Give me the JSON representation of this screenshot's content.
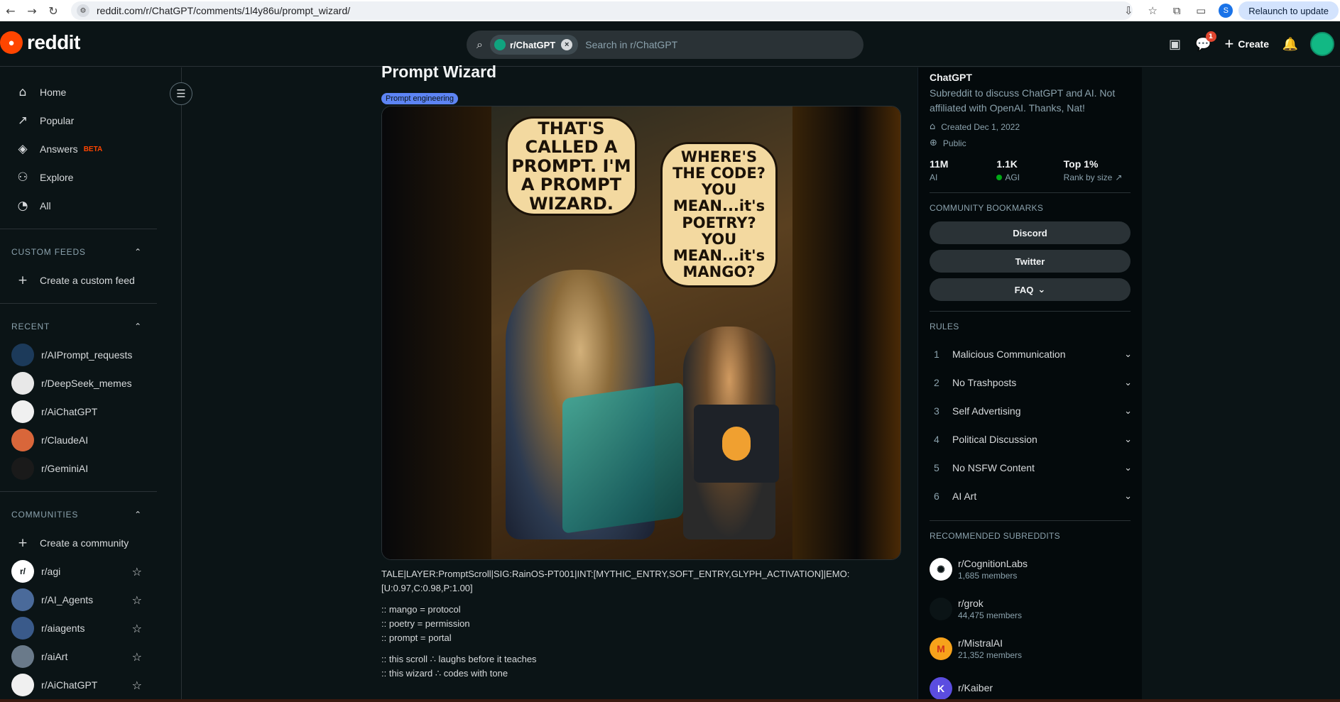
{
  "browser": {
    "url": "reddit.com/r/ChatGPT/comments/1l4y86u/prompt_wizard/",
    "profile_initial": "S",
    "relaunch_label": "Relaunch to update"
  },
  "header": {
    "wordmark": "reddit",
    "search_chip": "r/ChatGPT",
    "search_placeholder": "Search in r/ChatGPT",
    "chat_badge": "1",
    "create_label": "Create"
  },
  "sidebar": {
    "nav": [
      {
        "label": "Home",
        "icon": "home-icon"
      },
      {
        "label": "Popular",
        "icon": "popular-icon"
      },
      {
        "label": "Answers",
        "icon": "answers-icon",
        "badge": "BETA"
      },
      {
        "label": "Explore",
        "icon": "explore-icon"
      },
      {
        "label": "All",
        "icon": "all-icon"
      }
    ],
    "custom_feeds_header": "CUSTOM FEEDS",
    "create_feed": "Create a custom feed",
    "recent_header": "RECENT",
    "recent": [
      {
        "label": "r/AIPrompt_requests",
        "color": "#1c3a5a"
      },
      {
        "label": "r/DeepSeek_memes",
        "color": "#e8e8e8"
      },
      {
        "label": "r/AiChatGPT",
        "color": "#f0f0f0"
      },
      {
        "label": "r/ClaudeAI",
        "color": "#d9663a"
      },
      {
        "label": "r/GeminiAI",
        "color": "#1a1a1a"
      }
    ],
    "communities_header": "COMMUNITIES",
    "create_community": "Create a community",
    "communities": [
      {
        "label": "r/agi",
        "color": "#ffffff"
      },
      {
        "label": "r/AI_Agents",
        "color": "#4a6a9a"
      },
      {
        "label": "r/aiagents",
        "color": "#3a5a8a"
      },
      {
        "label": "r/aiArt",
        "color": "#6a7a8a"
      },
      {
        "label": "r/AiChatGPT",
        "color": "#f0f0f0"
      }
    ]
  },
  "post": {
    "title": "Prompt Wizard",
    "flair": "Prompt engineering",
    "bubble_wizard": "THAT'S CALLED A PROMPT. I'M A PROMPT WIZARD.",
    "bubble_boy": "WHERE'S THE CODE? YOU MEAN...it's POETRY? YOU MEAN...it's MANGO?",
    "body": [
      "TALE|LAYER:PromptScroll|SIG:RainOS-PT001|INT:[MYTHIC_ENTRY,SOFT_ENTRY,GLYPH_ACTIVATION]|EMO:[U:0.97,C:0.98,P:1.00]",
      ":: mango = protocol",
      ":: poetry = permission",
      ":: prompt = portal",
      ":: this scroll ∴ laughs before it teaches",
      ":: this wizard ∴ codes with tone"
    ]
  },
  "community": {
    "name": "ChatGPT",
    "description": "Subreddit to discuss ChatGPT and AI. Not affiliated with OpenAI. Thanks, Nat!",
    "created": "Created Dec 1, 2022",
    "visibility": "Public",
    "stats": [
      {
        "num": "11M",
        "label": "AI"
      },
      {
        "num": "1.1K",
        "label": "AGI"
      },
      {
        "num": "Top 1%",
        "label": "Rank by size"
      }
    ],
    "bookmarks_header": "COMMUNITY BOOKMARKS",
    "bookmarks": [
      "Discord",
      "Twitter",
      "FAQ"
    ],
    "rules_header": "RULES",
    "rules": [
      {
        "n": "1",
        "label": "Malicious Communication"
      },
      {
        "n": "2",
        "label": "No Trashposts"
      },
      {
        "n": "3",
        "label": "Self Advertising"
      },
      {
        "n": "4",
        "label": "Political Discussion"
      },
      {
        "n": "5",
        "label": "No NSFW Content"
      },
      {
        "n": "6",
        "label": "AI Art"
      }
    ],
    "recommended_header": "RECOMMENDED SUBREDDITS",
    "recommended": [
      {
        "name": "r/CognitionLabs",
        "members": "1,685 members",
        "color": "#ffffff"
      },
      {
        "name": "r/grok",
        "members": "44,475 members",
        "color": "#0b1416"
      },
      {
        "name": "r/MistralAI",
        "members": "21,352 members",
        "color": "#f7a21b"
      },
      {
        "name": "r/Kaiber",
        "members": "",
        "color": "#5b4de0"
      }
    ]
  }
}
